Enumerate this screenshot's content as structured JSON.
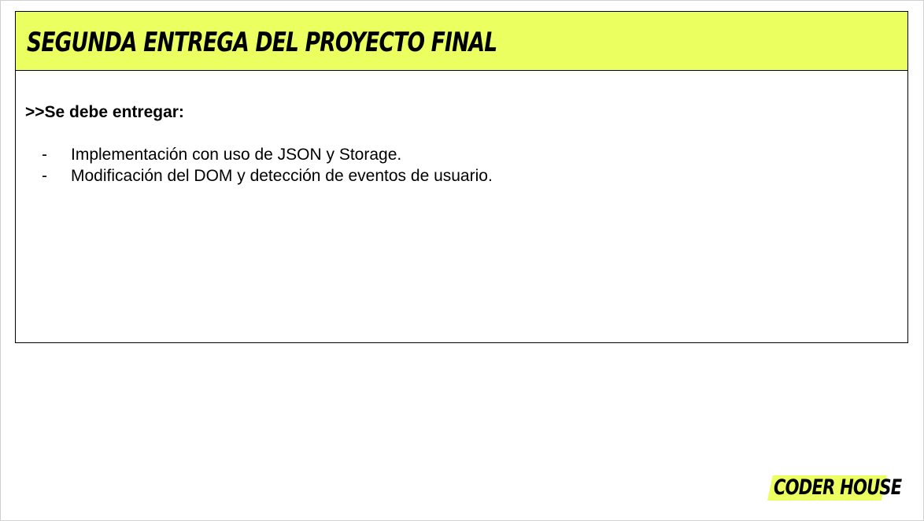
{
  "slide": {
    "title": "SEGUNDA ENTREGA DEL PROYECTO FINAL",
    "intro": ">>Se debe entregar:",
    "bullet_marker": "-",
    "bullets": [
      "Implementación con uso de JSON y Storage.",
      "Modificación del DOM y detección de eventos de usuario."
    ]
  },
  "logo": {
    "text": "CODER HOUSE"
  },
  "colors": {
    "accent": "#ebff61",
    "border": "#000000",
    "background": "#ffffff"
  }
}
